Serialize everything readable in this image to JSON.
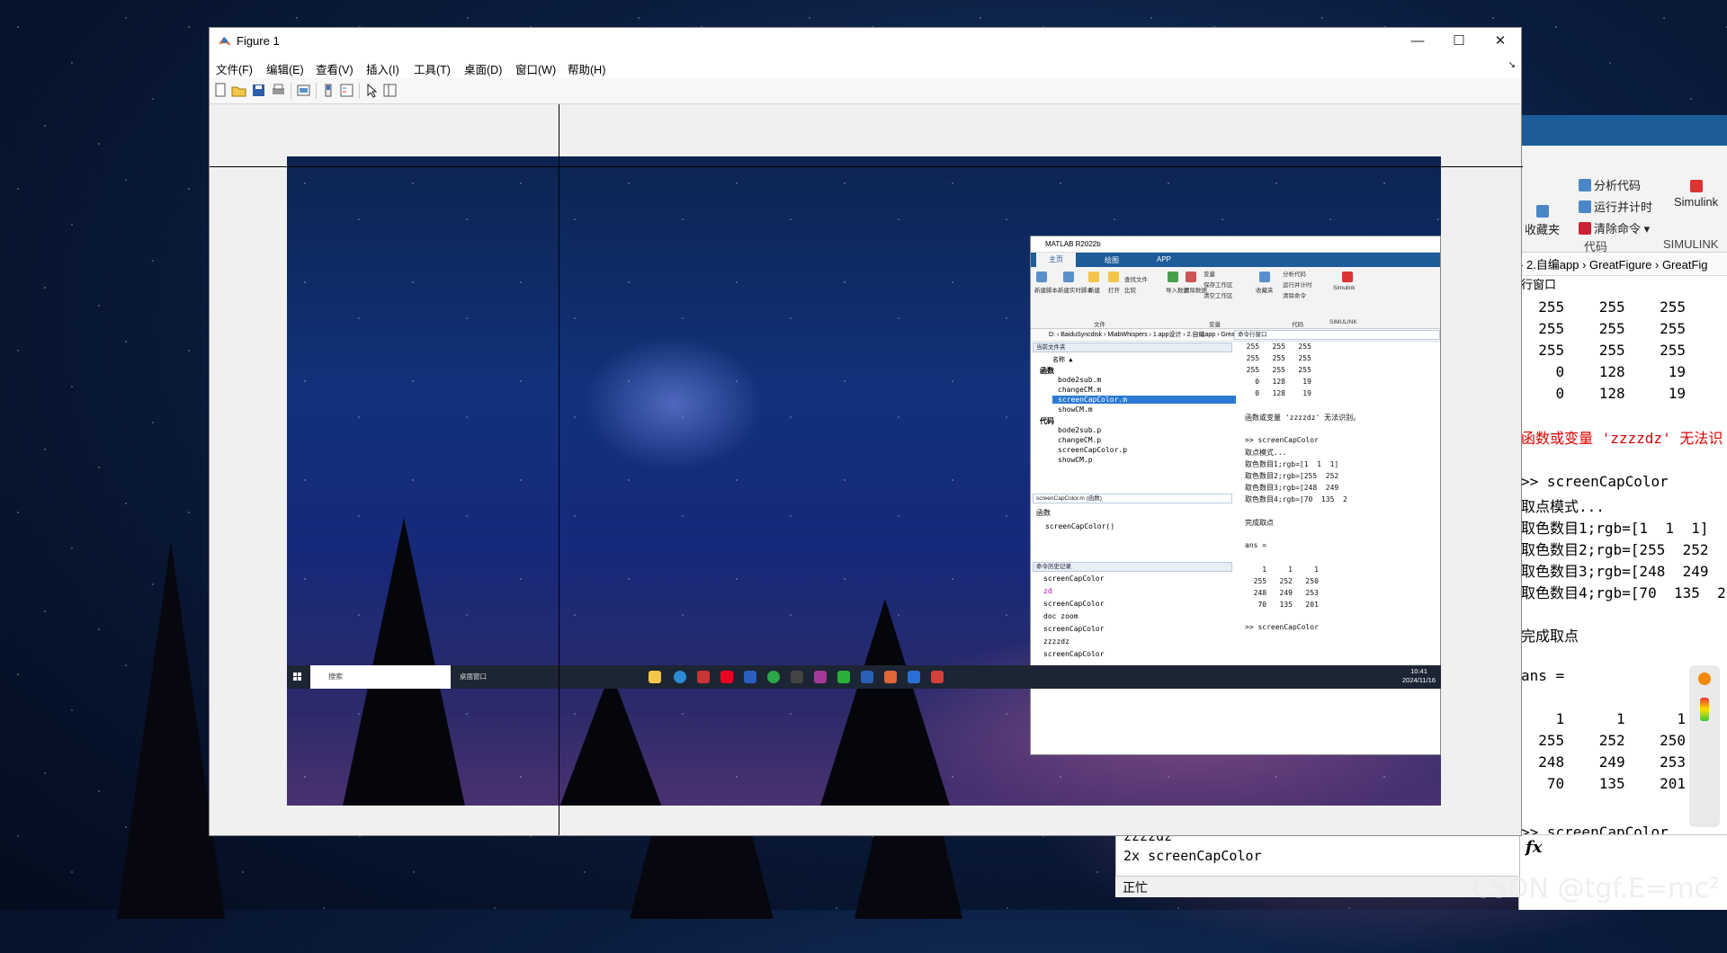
{
  "figure": {
    "title": "Figure 1",
    "menu": [
      "文件(F)",
      "编辑(E)",
      "查看(V)",
      "插入(I)",
      "工具(T)",
      "桌面(D)",
      "窗口(W)",
      "帮助(H)"
    ],
    "window_controls": {
      "minimize": "—",
      "maximize": "☐",
      "close": "✕"
    }
  },
  "capture": {
    "title": "MATLAB R2022b",
    "tabs": [
      "主页",
      "绘图",
      "APP"
    ],
    "ribbon_labels": [
      "新建脚本",
      "新建实时脚本",
      "新建",
      "打开",
      "查找文件",
      "比较",
      "导入数据",
      "清除数据",
      "变量",
      "保存工作区",
      "清空工作区",
      "收藏夹",
      "分析代码",
      "运行并计时",
      "清除命令",
      "Simulink"
    ],
    "ribbon_groups": [
      "文件",
      "变量",
      "代码",
      "SIMULINK"
    ],
    "path": "D: › BaiduSyncdisk › MlabWhispers › 1.app设计 › 2.自编app › GreatFigure › GreatFig",
    "folder_header": "当前文件夹",
    "name_col": "名称 ▲",
    "group_func": "函数",
    "group_code": "代码",
    "func_files": [
      "bode2sub.m",
      "changeCM.m",
      "screenCapColor.m",
      "showCM.m"
    ],
    "code_files": [
      "bode2sub.p",
      "changeCM.p",
      "screenCapColor.p",
      "showCM.p"
    ],
    "details_header": "screenCapColor.m (函数)",
    "details_title": "函数",
    "details_sig": "screenCapColor()",
    "history_header": "命令历史记录",
    "history": [
      "screenCapColor",
      "zd",
      "screenCapColor",
      "doc zoom",
      "screenCapColor",
      "zzzzdz",
      "screenCapColor"
    ],
    "status": "正忙",
    "cmd_header": "命令行窗口",
    "cmd_rows": [
      "  255   255   255",
      "  255   255   255",
      "  255   255   255",
      "    0   128    19",
      "    0   128    19"
    ],
    "cmd_error": "函数或变量 'zzzzdz' 无法识别。",
    "cmd_lines": [
      ">> screenCapColor",
      "取点模式...",
      "取色数目1;rgb=[1  1  1]",
      "取色数目2;rgb=[255  252",
      "取色数目3;rgb=[248  249",
      "取色数目4;rgb=[70  135  2"
    ],
    "cmd_done": "完成取点",
    "ans_label": "ans =",
    "ans_rows": [
      "    1     1     1",
      "  255   252   250",
      "  248   249   253",
      "   70   135   201"
    ],
    "cmd_prompt": ">> screenCapColor",
    "taskbar": {
      "search_placeholder": "搜索",
      "task_label": "桌面窗口",
      "time": "10:41",
      "date": "2024/11/16"
    }
  },
  "background_matlab": {
    "ribbon_items": [
      "收藏夹",
      "分析代码",
      "运行并计时",
      "清除命令 ▾",
      "Simulink"
    ],
    "ribbon_groups": [
      "代码",
      "SIMULINK"
    ],
    "path": "› 2.自编app › GreatFigure › GreatFig",
    "window_label": "行窗口",
    "rows": [
      "  255    255    255",
      "  255    255    255",
      "  255    255    255",
      "    0    128     19",
      "    0    128     19"
    ],
    "error": "函数或变量 'zzzzdz' 无法识",
    "lines": [
      ">> screenCapColor",
      "取点模式...",
      "取色数目1;rgb=[1  1  1]",
      "取色数目2;rgb=[255  252",
      "取色数目3;rgb=[248  249",
      "取色数目4;rgb=[70  135  2"
    ],
    "done": "完成取点",
    "ans": "ans =",
    "ans_rows": [
      "    1      1      1",
      "  255    252    250",
      "  248    249    253",
      "   70    135    201"
    ],
    "prompt": ">> screenCapColor",
    "history": [
      "zzzzdz",
      "2x screenCapColor"
    ],
    "status": "正忙",
    "fx": "fx"
  },
  "watermark": "CSDN @tgf.E=mc²"
}
